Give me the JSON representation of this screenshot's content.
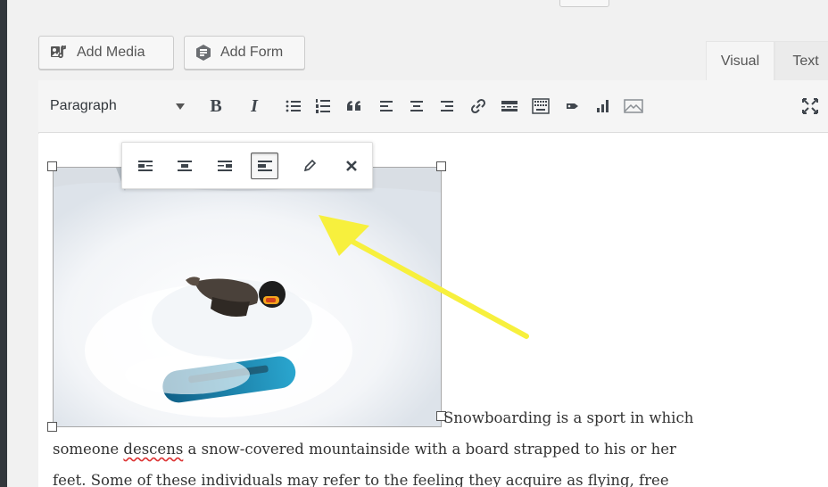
{
  "media_buttons": {
    "add_media": "Add Media",
    "add_form": "Add Form"
  },
  "tabs": {
    "visual": "Visual",
    "text": "Text"
  },
  "toolbar": {
    "format_select": "Paragraph",
    "bold": "B",
    "italic": "I"
  },
  "content": {
    "first_line": "Snowboarding is a sport in which",
    "second_line_start": "someone ",
    "misspelled_word": "descens",
    "second_line_end": " a snow-covered mountainside with a board strapped to his or her",
    "third_line": "feet. Some of these individuals may refer to the feeling they acquire as flying, free"
  },
  "colors": {
    "annotation_arrow": "#f7f03d",
    "spellcheck_underline": "#dc3232"
  },
  "icons": {
    "add_media": "add-media-icon",
    "add_form": "add-form-icon",
    "bullet_list": "bullet-list-icon",
    "numbered_list": "numbered-list-icon",
    "blockquote": "blockquote-icon",
    "align_left": "align-left-icon",
    "align_center": "align-center-icon",
    "align_right": "align-right-icon",
    "link": "link-icon",
    "read_more": "read-more-icon",
    "toggle_toolbar": "toggle-toolbar-icon",
    "tag": "tag-icon",
    "chart": "chart-icon",
    "mail": "mail-icon",
    "fullscreen": "fullscreen-icon",
    "edit": "pencil-icon",
    "remove": "close-icon"
  }
}
